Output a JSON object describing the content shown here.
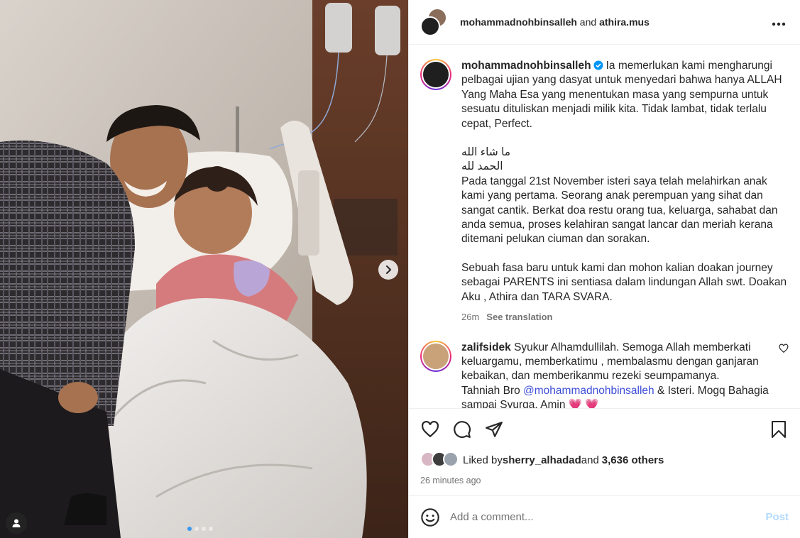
{
  "header": {
    "user1": "mohammadnohbinsalleh",
    "joiner": " and ",
    "user2": "athira.mus",
    "more_icon": "more-horizontal-icon"
  },
  "caption": {
    "username": "mohammadnohbinsalleh",
    "para1": "Ia memerlukan kami mengharungi pelbagai ujian yang dasyat untuk menyedari bahwa hanya ALLAH Yang Maha Esa yang menentukan masa yang sempurna untuk sesuatu dituliskan menjadi milik kita. Tidak lambat, tidak terlalu cepat, Perfect.",
    "arabic1": "ما شاء الله",
    "arabic2": "الحمد لله",
    "para2": "Pada tanggal 21st November isteri saya telah melahirkan anak kami yang pertama. Seorang anak perempuan yang sihat dan sangat cantik. Berkat doa restu orang tua, keluarga, sahabat dan anda semua, proses kelahiran sangat lancar dan meriah kerana ditemani pelukan ciuman dan sorakan.",
    "para3": "Sebuah fasa baru untuk kami dan mohon kalian doakan journey sebagai PARENTS ini sentiasa dalam lindungan Allah swt. Doakan Aku , Athira dan TARA SVARA.",
    "time": "26m",
    "see_translation": "See translation"
  },
  "comment": {
    "username": "zalifsidek",
    "text1": "Syukur Alhamdullilah. Semoga Allah memberkati keluargamu, memberkatimu , membalasmu dengan ganjaran kebaikan, dan memberikanmu rezeki seumpamanya.",
    "text2a": "Tahniah Bro ",
    "mention": "@mohammadnohbinsalleh",
    "text2b": " & Isteri. Mogq Bahagia sampai Syurga. Amin ",
    "hearts": "💗 💗"
  },
  "likes": {
    "prefix": "Liked by ",
    "user": "sherry_alhadad",
    "middle": " and ",
    "count": "3,636 others"
  },
  "post_time": "26 minutes ago",
  "add_comment": {
    "placeholder": "Add a comment...",
    "post_label": "Post"
  },
  "carousel": {
    "total": 4,
    "active_index": 0
  },
  "colors": {
    "link": "#3d4ed8",
    "post_disabled": "#b3dbff",
    "active_dot": "#3897f0",
    "heart_emoji": "#e6185a"
  }
}
